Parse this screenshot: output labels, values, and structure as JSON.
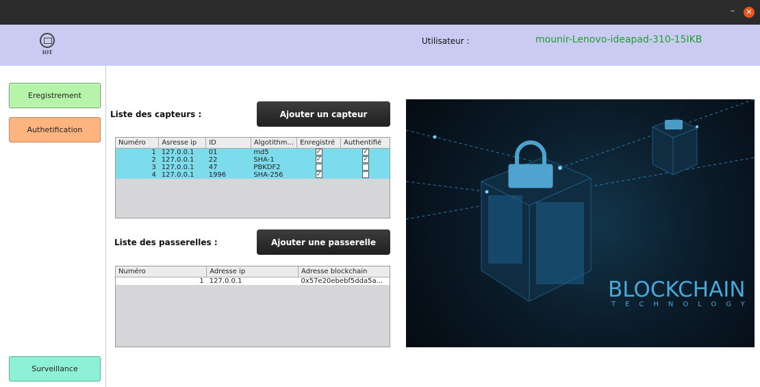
{
  "window": {
    "minimize": "–",
    "close": "✕"
  },
  "header": {
    "logo_text": "IOT",
    "user_label": "Utilisateur :",
    "user_name": "mounir-Lenovo-ideapad-310-15IKB"
  },
  "sidebar": {
    "registration": "Eregistrement",
    "authentication": "Authetification",
    "surveillance": "Surveillance"
  },
  "sensors": {
    "label": "Liste des capteurs :",
    "add_button": "Ajouter un capteur",
    "columns": [
      "Numéro",
      "Asresse ip",
      "ID",
      "Algotithm...",
      "Enregistré",
      "Authentifié"
    ],
    "rows": [
      {
        "num": "1",
        "ip": "127.0.0.1",
        "id": "01",
        "algo": "md5",
        "registered": "✓",
        "authenticated": "✓"
      },
      {
        "num": "2",
        "ip": "127.0.0.1",
        "id": "22",
        "algo": "SHA-1",
        "registered": "✓",
        "authenticated": "✓"
      },
      {
        "num": "3",
        "ip": "127.0.0.1",
        "id": "47",
        "algo": "PBKDF2",
        "registered": "",
        "authenticated": ""
      },
      {
        "num": "4",
        "ip": "127.0.0.1",
        "id": "1996",
        "algo": "SHA-256",
        "registered": "✓",
        "authenticated": ""
      }
    ]
  },
  "gateways": {
    "label": "Liste des passerelles :",
    "add_button": "Ajouter une passerelle",
    "columns": [
      "Numéro",
      "Adresse ip",
      "Adresse blockchain"
    ],
    "rows": [
      {
        "num": "1",
        "ip": "127.0.0.1",
        "address": "0x57e20ebebf5dda5a..."
      }
    ]
  },
  "banner": {
    "title": "BLOCKCHAIN",
    "subtitle": "TECHNOLOGY"
  },
  "colors": {
    "header_bg": "#c9cbf2",
    "user_name": "#1f9d2f",
    "selected_row": "#7ddcec",
    "banner_text": "#4aa8d8"
  }
}
